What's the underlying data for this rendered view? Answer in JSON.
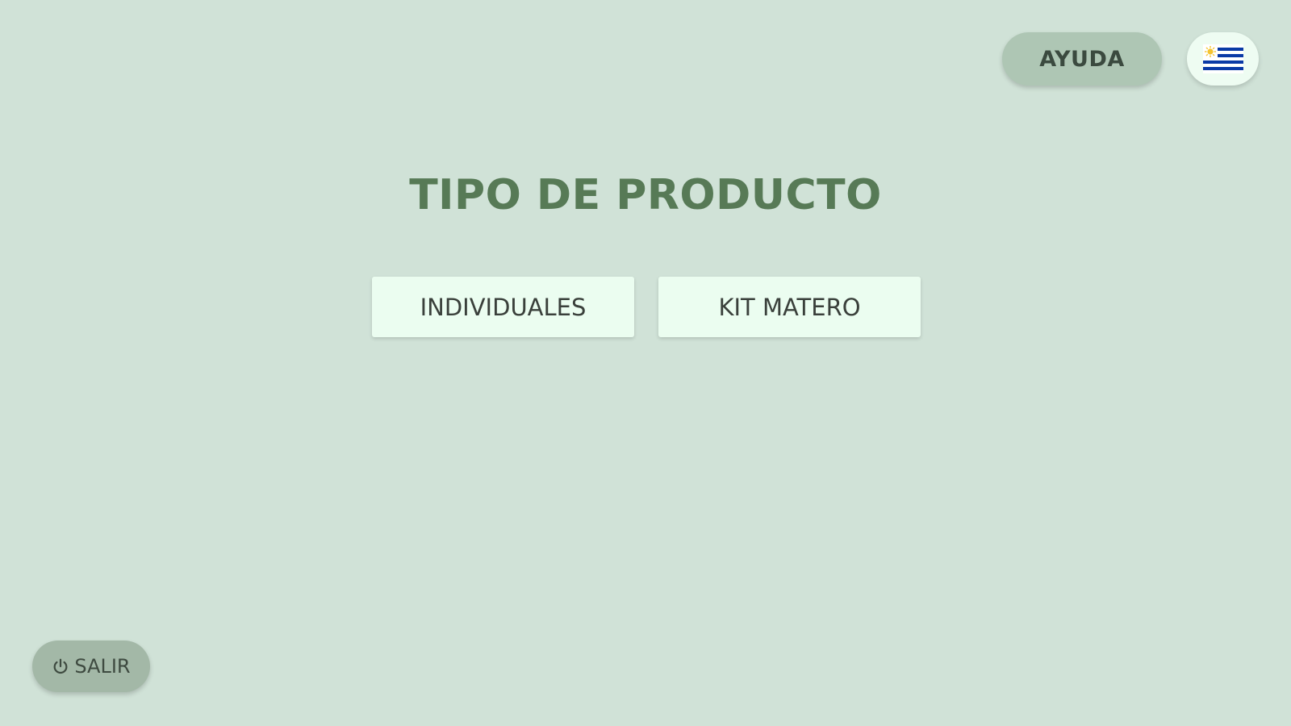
{
  "header": {
    "help_label": "AYUDA",
    "language_icon": "uruguay-flag-icon"
  },
  "main": {
    "title": "TIPO DE PRODUCTO",
    "options": [
      {
        "label": "INDIVIDUALES"
      },
      {
        "label": "KIT MATERO"
      }
    ]
  },
  "footer": {
    "exit_label": "SALIR",
    "exit_icon": "power-icon"
  },
  "colors": {
    "background": "#d0e2d7",
    "title": "#577a56",
    "option_button": "#ebfdf0",
    "help_button": "#aec6b4",
    "exit_button": "#a3b8a7",
    "flag_blue": "#0a3aa6",
    "flag_sun": "#f4c430"
  }
}
